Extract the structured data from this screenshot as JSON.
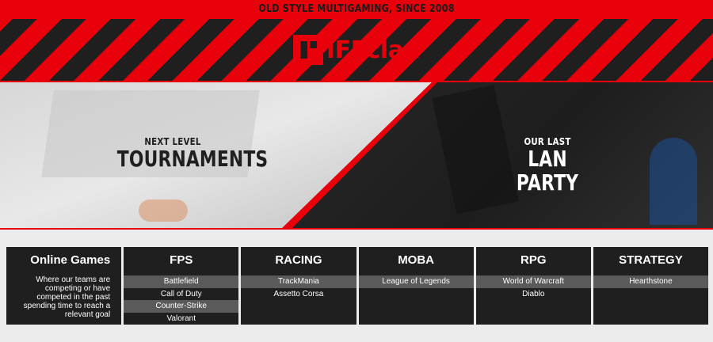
{
  "topbar": {
    "text": "OLD STYLE MULTIGAMING, SINCE 2008"
  },
  "logo": {
    "text": "IFFclan"
  },
  "hero": {
    "left": {
      "small": "NEXT LEVEL",
      "big": "TOURNAMENTS"
    },
    "right": {
      "small": "OUR LAST",
      "big": "LAN PARTY"
    }
  },
  "intro": {
    "title": "Online Games",
    "description": "Where our teams are competing or have competed in the past spending time to reach a relevant goal"
  },
  "categories": [
    {
      "name": "FPS",
      "games": [
        "Battlefield",
        "Call of Duty",
        "Counter-Strike",
        "Valorant"
      ]
    },
    {
      "name": "RACING",
      "games": [
        "TrackMania",
        "Assetto Corsa"
      ]
    },
    {
      "name": "MOBA",
      "games": [
        "League of Legends"
      ]
    },
    {
      "name": "RPG",
      "games": [
        "World of Warcraft",
        "Diablo"
      ]
    },
    {
      "name": "STRATEGY",
      "games": [
        "Hearthstone"
      ]
    }
  ],
  "colors": {
    "brand_red": "#e8000b",
    "dark": "#1f1f1f",
    "row_alt": "#5a5a5a"
  }
}
